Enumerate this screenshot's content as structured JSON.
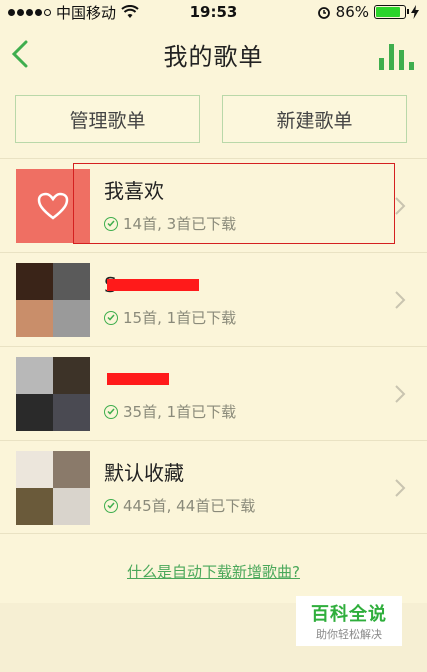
{
  "status_bar": {
    "carrier": "中国移动",
    "time": "19:53",
    "battery_percent": "86%",
    "battery_level": 0.86
  },
  "nav": {
    "title": "我的歌单",
    "back_icon": "chevron-left-icon",
    "equalizer_icon": "equalizer-icon"
  },
  "actions": {
    "manage_label": "管理歌单",
    "create_label": "新建歌单"
  },
  "playlists": [
    {
      "title": "我喜欢",
      "subtitle": "14首, 3首已下载",
      "cover": "heart-icon"
    },
    {
      "title": "S",
      "subtitle": "15首, 1首已下载",
      "cover": "album-grid"
    },
    {
      "title": "",
      "subtitle": "35首, 1首已下载",
      "cover": "album-grid"
    },
    {
      "title": "默认收藏",
      "subtitle": "445首, 44首已下载",
      "cover": "album-grid"
    }
  ],
  "footer": {
    "link": "什么是自动下载新增歌曲?"
  },
  "watermark": {
    "title": "百科全说",
    "subtitle": "助你轻松解决"
  },
  "colors": {
    "accent": "#3fae4e",
    "background": "#fbf5d9",
    "heart_cover": "#ef6f63",
    "highlight": "#d42020"
  }
}
